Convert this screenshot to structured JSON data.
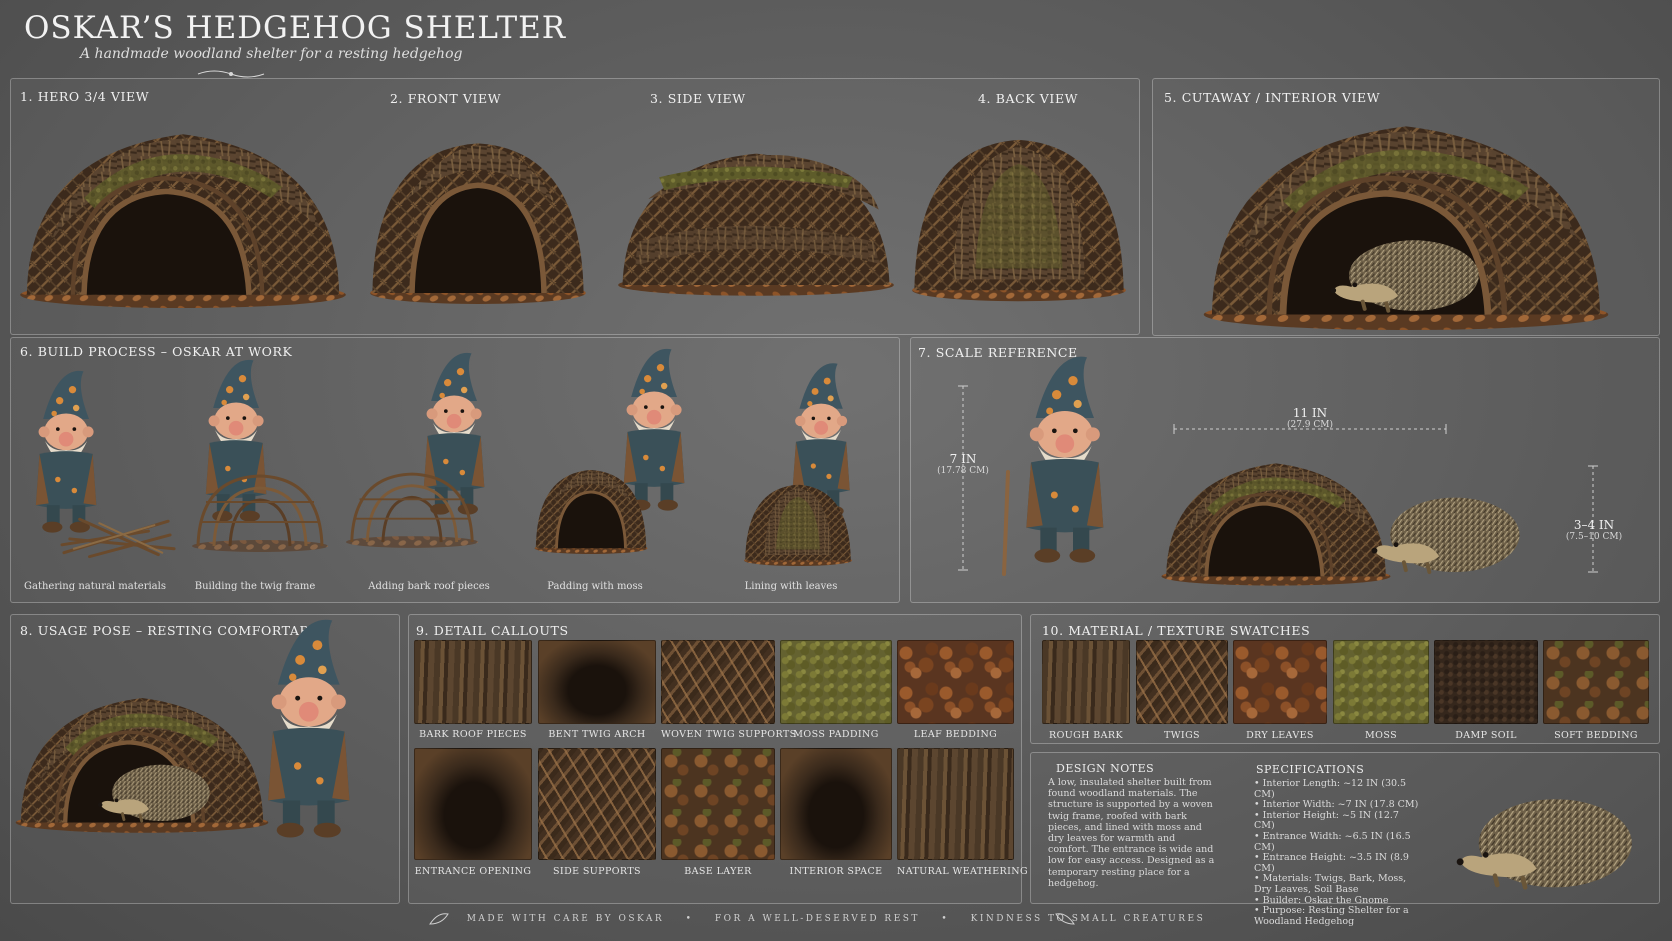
{
  "header": {
    "title": "OSKAR’S HEDGEHOG SHELTER",
    "subtitle": "A handmade woodland shelter for a resting hedgehog"
  },
  "views": {
    "hero": "1. HERO 3/4 VIEW",
    "front": "2. FRONT VIEW",
    "side": "3. SIDE VIEW",
    "back": "4. BACK VIEW",
    "cutaway": "5. CUTAWAY / INTERIOR VIEW"
  },
  "build": {
    "title": "6. BUILD PROCESS – OSKAR AT WORK",
    "steps": [
      "Gathering natural materials",
      "Building the twig frame",
      "Adding bark roof pieces",
      "Padding with moss",
      "Lining with leaves"
    ]
  },
  "scale": {
    "title": "7. SCALE REFERENCE",
    "gnome_height": "7 IN",
    "gnome_height_cm": "(17.78 CM)",
    "shelter_length": "11 IN",
    "shelter_length_cm": "(27.9 CM)",
    "hedgehog_height": "3–4 IN",
    "hedgehog_height_cm": "(7.5–10 CM)"
  },
  "usage": {
    "title": "8. USAGE POSE – RESTING COMFORTABLY"
  },
  "details": {
    "title": "9. DETAIL CALLOUTS",
    "items": [
      "BARK ROOF PIECES",
      "BENT TWIG ARCH",
      "WOVEN TWIG SUPPORTS",
      "MOSS PADDING",
      "LEAF BEDDING",
      "ENTRANCE OPENING",
      "SIDE SUPPORTS",
      "BASE LAYER",
      "INTERIOR SPACE",
      "NATURAL WEATHERING"
    ]
  },
  "materials": {
    "title": "10. MATERIAL / TEXTURE SWATCHES",
    "items": [
      "ROUGH BARK",
      "TWIGS",
      "DRY LEAVES",
      "MOSS",
      "DAMP SOIL",
      "SOFT BEDDING"
    ]
  },
  "design_notes": {
    "title": "DESIGN NOTES",
    "body": "A low, insulated shelter built from found woodland materials. The structure is supported by a woven twig frame, roofed with bark pieces, and lined with moss and dry leaves for warmth and comfort. The entrance is wide and low for easy access. Designed as a temporary resting place for a hedgehog."
  },
  "specifications": {
    "title": "SPECIFICATIONS",
    "items": [
      "Interior Length: ~12 IN (30.5 CM)",
      "Interior Width: ~7 IN (17.8 CM)",
      "Interior Height: ~5 IN (12.7 CM)",
      "Entrance Width: ~6.5 IN (16.5 CM)",
      "Entrance Height: ~3.5 IN (8.9 CM)",
      "Materials: Twigs, Bark, Moss, Dry Leaves, Soil Base",
      "Builder: Oskar the Gnome",
      "Purpose: Resting Shelter for a Woodland Hedgehog"
    ]
  },
  "footer": {
    "left": "MADE WITH CARE BY OSKAR",
    "middle": "FOR A WELL-DESERVED REST",
    "right": "KINDNESS TO SMALL CREATURES",
    "separator": "•"
  },
  "colors": {
    "background": "#5a5a5a",
    "bark": "#5c4630",
    "moss": "#646230",
    "leaf": "#8c5028",
    "gnome_hat": "#3e5560",
    "hedgehog": "#8a7a5e"
  }
}
